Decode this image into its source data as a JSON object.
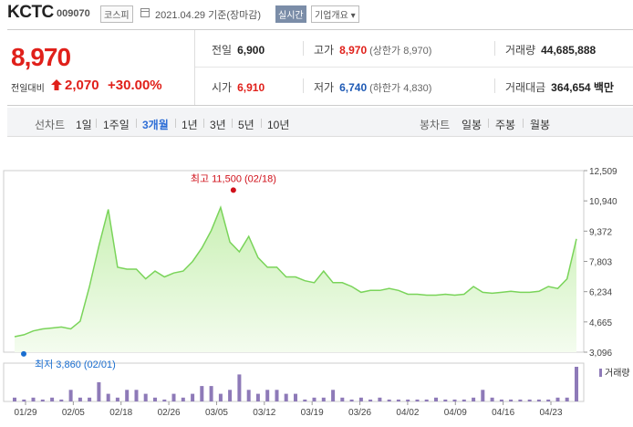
{
  "header": {
    "name": "KCTC",
    "code": "009070",
    "market": "코스피",
    "date": "2021.04.29 기준(장마감)",
    "live": "실시간",
    "corp_info": "기업개요 ▾"
  },
  "quote": {
    "price": "8,970",
    "change_label": "전일대비",
    "change": "2,070",
    "change_pct": "+30.00%",
    "row1": [
      {
        "label": "전일",
        "value": "6,900",
        "color": "default"
      },
      {
        "label": "고가",
        "value": "8,970",
        "sub": "(상한가 8,970)",
        "color": "red"
      },
      {
        "label": "거래량",
        "value": "44,685,888",
        "color": "default"
      }
    ],
    "row2": [
      {
        "label": "시가",
        "value": "6,910",
        "color": "red"
      },
      {
        "label": "저가",
        "value": "6,740",
        "sub": "(하한가 4,830)",
        "color": "blue"
      },
      {
        "label": "거래대금",
        "value": "364,654 백만",
        "color": "default"
      }
    ]
  },
  "periods": {
    "line_label": "선차트",
    "line_items": [
      "1일",
      "1주일",
      "3개월",
      "1년",
      "3년",
      "5년",
      "10년"
    ],
    "active": "3개월",
    "candle_label": "봉차트",
    "candle_items": [
      "일봉",
      "주봉",
      "월봉"
    ]
  },
  "chart_data": {
    "type": "area",
    "y_ticks": [
      "12,509",
      "10,940",
      "9,372",
      "7,803",
      "6,234",
      "4,665",
      "3,096"
    ],
    "ylim": [
      3096,
      12509
    ],
    "x_ticks": [
      "01/29",
      "02/05",
      "02/18",
      "02/26",
      "03/05",
      "03/12",
      "03/19",
      "03/26",
      "04/02",
      "04/09",
      "04/16",
      "04/23"
    ],
    "high_label": "최고 11,500 (02/18)",
    "low_label": "최저 3,860 (02/01)",
    "high_value": 11500,
    "low_value": 3860,
    "volume_legend": "거래량",
    "colors": {
      "line": "#7ad45a",
      "fill_top": "#c9f0b4",
      "fill_bottom": "#f4fcef",
      "volume": "#8e7ab8",
      "high": "#d0101a",
      "low": "#1a6ed0"
    },
    "prices": [
      3900,
      4000,
      4200,
      4300,
      4350,
      4400,
      4300,
      4700,
      6500,
      8600,
      10500,
      7500,
      7400,
      7400,
      6900,
      7300,
      7000,
      7200,
      7300,
      7800,
      8500,
      9400,
      10600,
      8800,
      8300,
      9100,
      8000,
      7500,
      7500,
      7000,
      7000,
      6800,
      6700,
      7300,
      6700,
      6700,
      6500,
      6200,
      6300,
      6300,
      6400,
      6300,
      6100,
      6100,
      6050,
      6050,
      6100,
      6050,
      6100,
      6500,
      6200,
      6150,
      6200,
      6250,
      6200,
      6200,
      6250,
      6500,
      6400,
      6900,
      8970
    ],
    "volumes": [
      1,
      0.5,
      1,
      0.5,
      1,
      0.5,
      3,
      1,
      1,
      5,
      2,
      1,
      3,
      3,
      2,
      1,
      0.5,
      2,
      1,
      2,
      4,
      4,
      2,
      3,
      7,
      3,
      2,
      3,
      3,
      2,
      2,
      0.5,
      1,
      1,
      3,
      1,
      0.5,
      1,
      0.5,
      1,
      0.5,
      0.5,
      0.5,
      0.5,
      0.5,
      1,
      0.5,
      0.5,
      0.5,
      1,
      3,
      1,
      0.5,
      0.5,
      0.5,
      0.5,
      0.5,
      0.5,
      1,
      1,
      9
    ]
  }
}
